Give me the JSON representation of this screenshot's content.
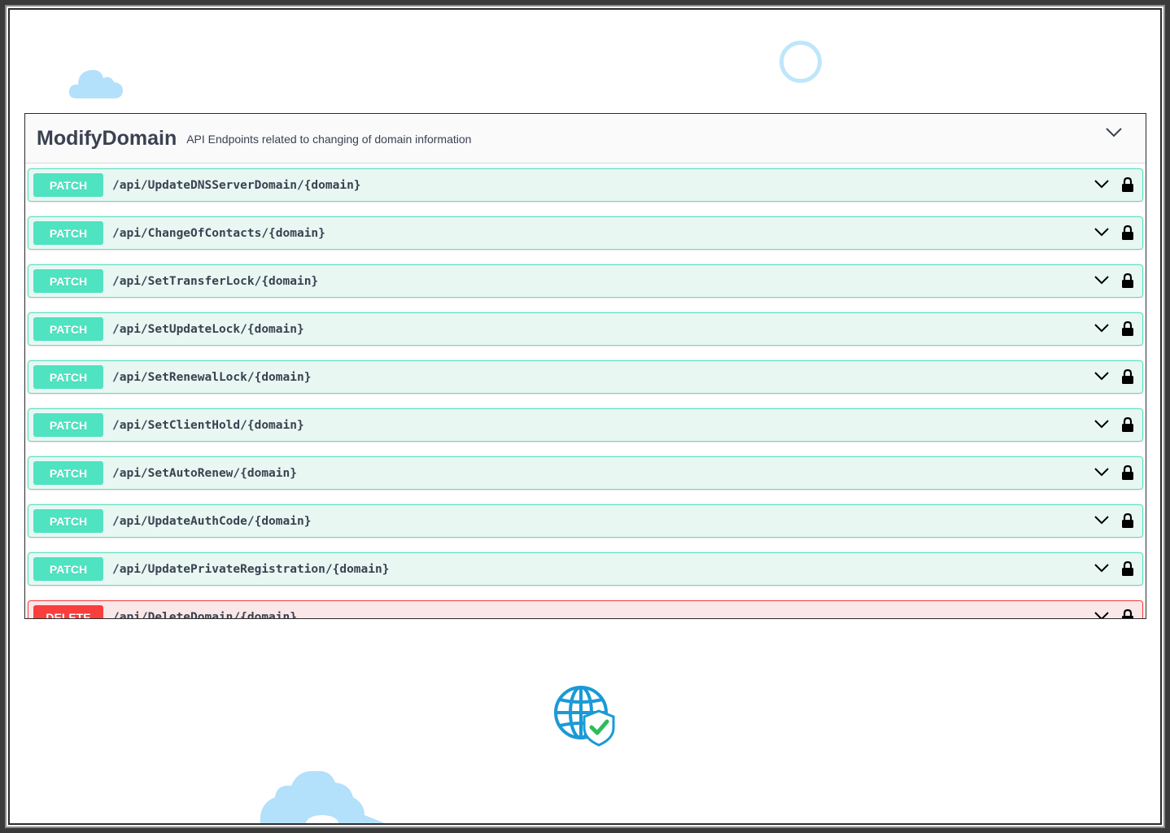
{
  "section": {
    "title": "ModifyDomain",
    "description": "API Endpoints related to changing of domain information",
    "chevron_icon": "chevron-down-icon"
  },
  "colors": {
    "patch": "#50e3c2",
    "patch_bg": "#e8f7f2",
    "delete": "#f93e3e",
    "delete_bg": "#fae7e7",
    "text": "#3b4151",
    "decor_blue": "#b3e0fb"
  },
  "operations": [
    {
      "method": "PATCH",
      "path": "/api/UpdateDNSServerDomain/{domain}"
    },
    {
      "method": "PATCH",
      "path": "/api/ChangeOfContacts/{domain}"
    },
    {
      "method": "PATCH",
      "path": "/api/SetTransferLock/{domain}"
    },
    {
      "method": "PATCH",
      "path": "/api/SetUpdateLock/{domain}"
    },
    {
      "method": "PATCH",
      "path": "/api/SetRenewalLock/{domain}"
    },
    {
      "method": "PATCH",
      "path": "/api/SetClientHold/{domain}"
    },
    {
      "method": "PATCH",
      "path": "/api/SetAutoRenew/{domain}"
    },
    {
      "method": "PATCH",
      "path": "/api/UpdateAuthCode/{domain}"
    },
    {
      "method": "PATCH",
      "path": "/api/UpdatePrivateRegistration/{domain}"
    },
    {
      "method": "DELETE",
      "path": "/api/DeleteDomain/{domain}"
    }
  ],
  "icons": {
    "expand": "chevron-down-icon",
    "auth": "lock-icon",
    "decorations": [
      "cloud-icon",
      "ring-icon",
      "globe-shield-icon",
      "gear-icon"
    ]
  }
}
